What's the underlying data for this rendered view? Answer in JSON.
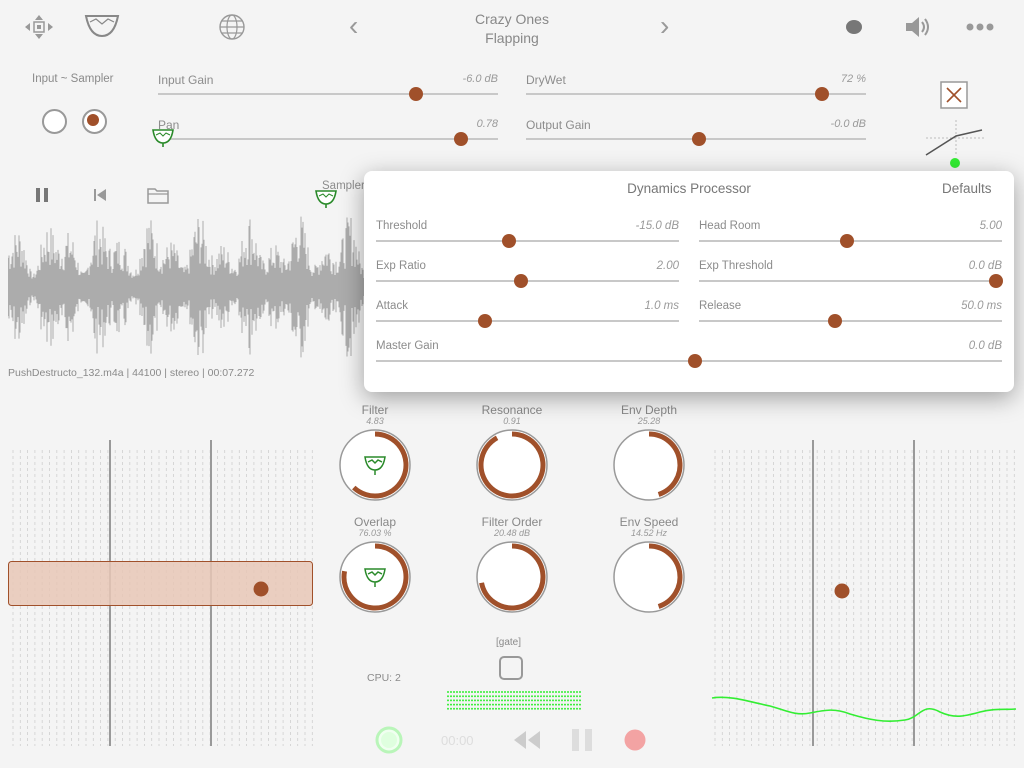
{
  "header": {
    "title_line1": "Crazy Ones",
    "title_line2": "Flapping",
    "prev_icon": "‹",
    "next_icon": "›",
    "icons": [
      "move-icon",
      "filter-shape-icon",
      "globe-icon",
      "record-dot-icon",
      "speaker-icon",
      "more-icon"
    ]
  },
  "input": {
    "label": "Input ~ Sampler",
    "selected": 1
  },
  "sliders": {
    "input_gain": {
      "label": "Input Gain",
      "value": "-6.0 dB",
      "level": 0.76
    },
    "pan": {
      "label": "Pan",
      "value": "0.78",
      "level": 0.89
    },
    "drywet": {
      "label": "DryWet",
      "value": "72 %",
      "level": 0.87
    },
    "output_gain": {
      "label": "Output Gain",
      "value": "-0.0 dB",
      "level": 0.51
    },
    "sampler": {
      "label": "Sampler"
    }
  },
  "transport_top": {
    "icons": [
      "pause-icon",
      "skip-back-icon",
      "folder-icon"
    ]
  },
  "waveform": {
    "file_info": "PushDestructo_132.m4a | 44100 | stereo  | 00:07.272"
  },
  "dynamics": {
    "title": "Dynamics Processor",
    "defaults_label": "Defaults",
    "threshold": {
      "label": "Threshold",
      "value": "-15.0 dB",
      "level": 0.44
    },
    "head_room": {
      "label": "Head Room",
      "value": "5.00",
      "level": 0.49
    },
    "exp_ratio": {
      "label": "Exp Ratio",
      "value": "2.00",
      "level": 0.48
    },
    "exp_threshold": {
      "label": "Exp Threshold",
      "value": "0.0 dB",
      "level": 0.98
    },
    "attack": {
      "label": "Attack",
      "value": "1.0 ms",
      "level": 0.36
    },
    "release": {
      "label": "Release",
      "value": "50.0 ms",
      "level": 0.45
    },
    "master_gain": {
      "label": "Master Gain",
      "value": "0.0 dB",
      "level": 0.51
    }
  },
  "knobs": [
    {
      "label": "Filter",
      "value": "4.83",
      "level": 0.62,
      "icon": true
    },
    {
      "label": "Resonance",
      "value": "0.91",
      "level": 0.92,
      "icon": false
    },
    {
      "label": "Env Depth",
      "value": "25.28",
      "level": 0.45,
      "icon": false
    },
    {
      "label": "Overlap",
      "value": "76.03 %",
      "level": 0.78,
      "icon": true
    },
    {
      "label": "Filter Order",
      "value": "20.48 dB",
      "level": 0.72,
      "icon": false
    },
    {
      "label": "Env Speed",
      "value": "14.52 Hz",
      "level": 0.45,
      "icon": false
    }
  ],
  "gate": {
    "label": "[gate]"
  },
  "cpu": {
    "label": "CPU: 2"
  },
  "bottom_transport": {
    "time": "00:00",
    "icons": [
      "play-ring-icon",
      "rewind-icon",
      "pause-icon",
      "record-icon"
    ]
  },
  "colors": {
    "accent": "#a0502a",
    "accent_fill": "#e8c7b6",
    "green": "#33ee33",
    "track": "#c8c8c8"
  }
}
